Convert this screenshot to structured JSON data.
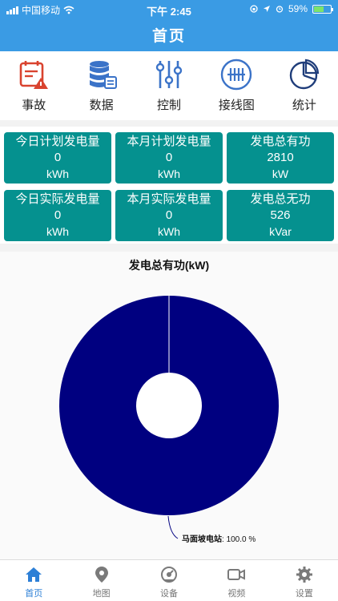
{
  "status": {
    "carrier": "中国移动",
    "time": "下午 2:45",
    "battery": "59%",
    "battery_level": 0.59
  },
  "header": {
    "title": "首页"
  },
  "nav_icons": [
    {
      "label": "事故",
      "icon": "accident-icon"
    },
    {
      "label": "数据",
      "icon": "database-icon"
    },
    {
      "label": "控制",
      "icon": "sliders-icon"
    },
    {
      "label": "接线图",
      "icon": "wiring-diagram-icon"
    },
    {
      "label": "统计",
      "icon": "pie-chart-icon"
    }
  ],
  "cards": [
    {
      "title": "今日计划发电量",
      "value": "0",
      "unit": "kWh"
    },
    {
      "title": "本月计划发电量",
      "value": "0",
      "unit": "kWh"
    },
    {
      "title": "发电总有功",
      "value": "2810",
      "unit": "kW"
    },
    {
      "title": "今日实际发电量",
      "value": "0",
      "unit": "kWh"
    },
    {
      "title": "本月实际发电量",
      "value": "0",
      "unit": "kWh"
    },
    {
      "title": "发电总无功",
      "value": "526",
      "unit": "kVar"
    }
  ],
  "colors": {
    "header": "#3a9be4",
    "card": "#05918f",
    "pie": "#000080",
    "active_tab": "#2c7fd6"
  },
  "chart_data": {
    "type": "pie",
    "title": "发电总有功(kW)",
    "slices": [
      {
        "label": "马面坡电站",
        "value": 100.0,
        "label_text": "100.0 %"
      }
    ]
  },
  "tabs": [
    {
      "label": "首页",
      "icon": "home-icon",
      "active": true
    },
    {
      "label": "地图",
      "icon": "map-pin-icon",
      "active": false
    },
    {
      "label": "设备",
      "icon": "device-icon",
      "active": false
    },
    {
      "label": "视频",
      "icon": "video-icon",
      "active": false
    },
    {
      "label": "设置",
      "icon": "settings-icon",
      "active": false
    }
  ]
}
